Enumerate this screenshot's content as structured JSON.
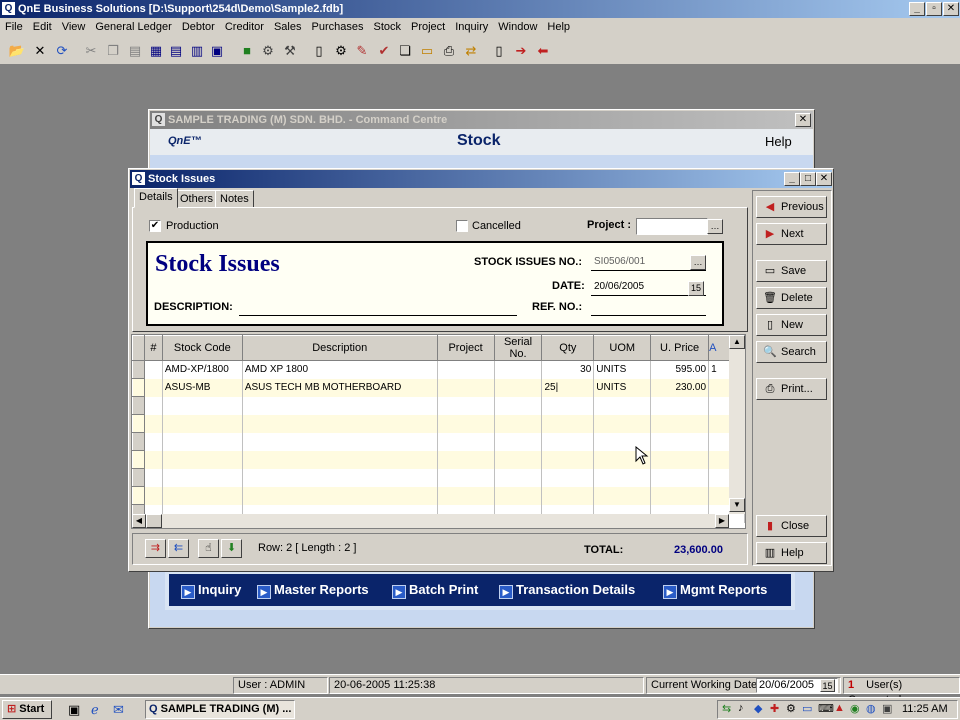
{
  "app": {
    "title": "QnE Business Solutions [D:\\Support\\254d\\Demo\\Sample2.fdb]",
    "window_controls": [
      "_",
      "▫",
      "✕"
    ]
  },
  "menu": [
    "File",
    "Edit",
    "View",
    "General Ledger",
    "Debtor",
    "Creditor",
    "Sales",
    "Purchases",
    "Stock",
    "Project",
    "Inquiry",
    "Window",
    "Help"
  ],
  "command_centre": {
    "title": "SAMPLE TRADING (M) SDN. BHD. - Command Centre",
    "logo": "QnE™",
    "heading": "Stock",
    "help": "Help",
    "nav": [
      "Inquiry",
      "Master Reports",
      "Batch Print",
      "Transaction Details",
      "Mgmt Reports"
    ]
  },
  "stock_issues": {
    "title": "Stock Issues",
    "tabs": [
      "Details",
      "Others",
      "Notes"
    ],
    "production_label": "Production",
    "production_checked": true,
    "cancelled_label": "Cancelled",
    "cancelled_checked": false,
    "project_label": "Project :",
    "project_value": "",
    "form_heading": "Stock Issues",
    "issues_no_label": "STOCK ISSUES NO.:",
    "issues_no_value": "SI0506/001",
    "date_label": "DATE:",
    "date_value": "20/06/2005",
    "description_label": "DESCRIPTION:",
    "description_value": "",
    "ref_label": "REF. NO.:",
    "ref_value": "",
    "grid": {
      "columns": [
        "#",
        "Stock Code",
        "Description",
        "Project",
        "Serial No.",
        "Qty",
        "UOM",
        "U. Price",
        "A"
      ],
      "rows": [
        {
          "code": "AMD-XP/1800",
          "desc": "AMD XP 1800",
          "project": "",
          "serial": "",
          "qty": "30",
          "uom": "UNITS",
          "price": "595.00",
          "a": "1"
        },
        {
          "code": "ASUS-MB",
          "desc": "ASUS TECH MB MOTHERBOARD",
          "project": "",
          "serial": "",
          "qty": "25",
          "uom": "UNITS",
          "price": "230.00",
          "a": ""
        }
      ]
    },
    "row_info": "Row: 2  [ Length : 2 ]",
    "total_label": "TOTAL:",
    "total_value": "23,600.00",
    "buttons": {
      "previous": "Previous",
      "next": "Next",
      "save": "Save",
      "delete": "Delete",
      "new": "New",
      "search": "Search",
      "print": "Print...",
      "close": "Close",
      "help": "Help"
    }
  },
  "status": {
    "user": "User : ADMIN",
    "datetime": "20-06-2005 11:25:38",
    "working_date_label": "Current Working Date :",
    "working_date": "20/06/2005",
    "connected_count": "1",
    "connected_label": "User(s) Connected."
  },
  "taskbar": {
    "start": "Start",
    "task": "SAMPLE TRADING (M) ...",
    "clock": "11:25 AM"
  }
}
